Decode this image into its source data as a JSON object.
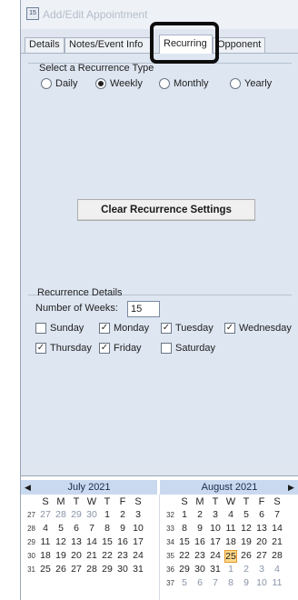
{
  "window": {
    "title": "Add/Edit Appointment",
    "app_icon": "calendar-icon"
  },
  "tabs": [
    {
      "label": "Details",
      "active": false
    },
    {
      "label": "Notes/Event Info",
      "active": false
    },
    {
      "label": "Recurring",
      "active": true
    },
    {
      "label": "Opponent",
      "active": false
    }
  ],
  "recurrence_type": {
    "label": "Select a Recurrence Type",
    "options": [
      "Daily",
      "Weekly",
      "Monthly",
      "Yearly"
    ],
    "selected": "Weekly"
  },
  "clear_button": {
    "label": "Clear Recurrence Settings"
  },
  "recurrence_details": {
    "label": "Recurrence Details",
    "weeks_label": "Number of Weeks:",
    "weeks_value": "15",
    "days": [
      {
        "label": "Sunday",
        "checked": false
      },
      {
        "label": "Monday",
        "checked": true
      },
      {
        "label": "Tuesday",
        "checked": true
      },
      {
        "label": "Wednesday",
        "checked": true
      },
      {
        "label": "Thursday",
        "checked": true
      },
      {
        "label": "Friday",
        "checked": true
      },
      {
        "label": "Saturday",
        "checked": false
      }
    ]
  },
  "calendar": {
    "accent": "#e39a2e",
    "header_bg": "#c9d9ef",
    "prev_icon": "triangle-left-icon",
    "next_icon": "triangle-right-icon",
    "dow": [
      "S",
      "M",
      "T",
      "W",
      "T",
      "F",
      "S"
    ],
    "months": [
      {
        "title": "July 2021",
        "weeks": [
          {
            "num": "27",
            "days": [
              [
                "27",
                true
              ],
              [
                "28",
                true
              ],
              [
                "29",
                true
              ],
              [
                "30",
                true
              ],
              [
                "1",
                false
              ],
              [
                "2",
                false
              ],
              [
                "3",
                false
              ]
            ]
          },
          {
            "num": "28",
            "days": [
              [
                "4",
                false
              ],
              [
                "5",
                false
              ],
              [
                "6",
                false
              ],
              [
                "7",
                false
              ],
              [
                "8",
                false
              ],
              [
                "9",
                false
              ],
              [
                "10",
                false
              ]
            ]
          },
          {
            "num": "29",
            "days": [
              [
                "11",
                false
              ],
              [
                "12",
                false
              ],
              [
                "13",
                false
              ],
              [
                "14",
                false
              ],
              [
                "15",
                false
              ],
              [
                "16",
                false
              ],
              [
                "17",
                false
              ]
            ]
          },
          {
            "num": "30",
            "days": [
              [
                "18",
                false
              ],
              [
                "19",
                false
              ],
              [
                "20",
                false
              ],
              [
                "21",
                false
              ],
              [
                "22",
                false
              ],
              [
                "23",
                false
              ],
              [
                "24",
                false
              ]
            ]
          },
          {
            "num": "31",
            "days": [
              [
                "25",
                false
              ],
              [
                "26",
                false
              ],
              [
                "27",
                false
              ],
              [
                "28",
                false
              ],
              [
                "29",
                false
              ],
              [
                "30",
                false
              ],
              [
                "31",
                false
              ]
            ]
          }
        ]
      },
      {
        "title": "August 2021",
        "today": "25",
        "weeks": [
          {
            "num": "32",
            "days": [
              [
                "1",
                false
              ],
              [
                "2",
                false
              ],
              [
                "3",
                false
              ],
              [
                "4",
                false
              ],
              [
                "5",
                false
              ],
              [
                "6",
                false
              ],
              [
                "7",
                false
              ]
            ]
          },
          {
            "num": "33",
            "days": [
              [
                "8",
                false
              ],
              [
                "9",
                false
              ],
              [
                "10",
                false
              ],
              [
                "11",
                false
              ],
              [
                "12",
                false
              ],
              [
                "13",
                false
              ],
              [
                "14",
                false
              ]
            ]
          },
          {
            "num": "34",
            "days": [
              [
                "15",
                false
              ],
              [
                "16",
                false
              ],
              [
                "17",
                false
              ],
              [
                "18",
                false
              ],
              [
                "19",
                false
              ],
              [
                "20",
                false
              ],
              [
                "21",
                false
              ]
            ]
          },
          {
            "num": "35",
            "days": [
              [
                "22",
                false
              ],
              [
                "23",
                false
              ],
              [
                "24",
                false
              ],
              [
                "25",
                false
              ],
              [
                "26",
                false
              ],
              [
                "27",
                false
              ],
              [
                "28",
                false
              ]
            ]
          },
          {
            "num": "36",
            "days": [
              [
                "29",
                false
              ],
              [
                "30",
                false
              ],
              [
                "31",
                false
              ],
              [
                "1",
                true
              ],
              [
                "2",
                true
              ],
              [
                "3",
                true
              ],
              [
                "4",
                true
              ]
            ]
          },
          {
            "num": "37",
            "days": [
              [
                "5",
                true
              ],
              [
                "6",
                true
              ],
              [
                "7",
                true
              ],
              [
                "8",
                true
              ],
              [
                "9",
                true
              ],
              [
                "10",
                true
              ],
              [
                "11",
                true
              ]
            ]
          }
        ]
      }
    ]
  }
}
